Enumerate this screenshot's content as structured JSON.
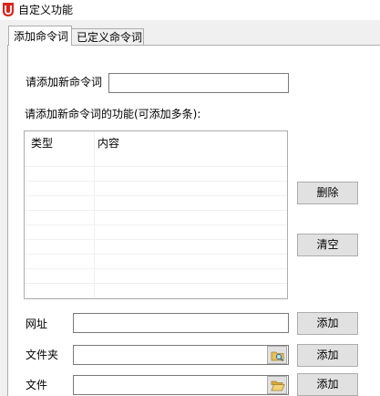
{
  "window": {
    "title": "自定义功能"
  },
  "tabs": [
    {
      "label": "添加命令词",
      "active": true
    },
    {
      "label": "已定义命令词",
      "active": false
    }
  ],
  "form": {
    "new_command_label": "请添加新命令词",
    "new_command_value": "",
    "functions_label": "请添加新命令词的功能(可添加多条):"
  },
  "function_table": {
    "columns": [
      "类型",
      "内容"
    ],
    "rows": []
  },
  "buttons": {
    "delete": "删除",
    "clear": "清空",
    "add_url": "添加",
    "add_folder": "添加",
    "add_file": "添加"
  },
  "fields": {
    "url_label": "网址",
    "url_value": "",
    "folder_label": "文件夹",
    "folder_value": "",
    "file_label": "文件",
    "file_value": ""
  },
  "colors": {
    "app_icon": "#d9261c",
    "window_bg": "#f0f0f0",
    "button_bg": "#e1e1e1",
    "border": "#adadad"
  }
}
